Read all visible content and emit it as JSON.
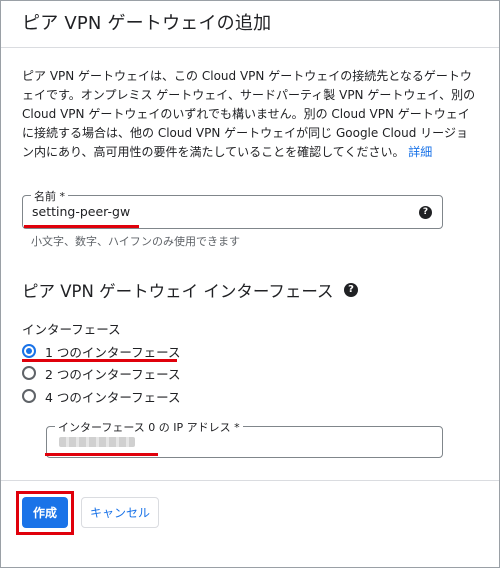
{
  "dialog": {
    "title": "ピア VPN ゲートウェイの追加"
  },
  "description": {
    "text": "ピア VPN ゲートウェイは、この Cloud VPN ゲートウェイの接続先となるゲートウェイです。オンプレミス ゲートウェイ、サードパーティ製 VPN ゲートウェイ、別の Cloud VPN ゲートウェイのいずれでも構いません。別の Cloud VPN ゲートウェイに接続する場合は、他の Cloud VPN ゲートウェイが同じ Google Cloud リージョン内にあり、高可用性の要件を満たしていることを確認してください。",
    "link_label": "詳細"
  },
  "name_field": {
    "label": "名前 *",
    "value": "setting-peer-gw",
    "hint": "小文字、数字、ハイフンのみ使用できます",
    "help_icon": "help-circle-icon"
  },
  "interface_section": {
    "title": "ピア VPN ゲートウェイ インターフェース",
    "help_icon": "help-circle-icon",
    "group_label": "インターフェース",
    "options": [
      {
        "label": "1 つのインターフェース",
        "checked": true
      },
      {
        "label": "2 つのインターフェース",
        "checked": false
      },
      {
        "label": "4 つのインターフェース",
        "checked": false
      }
    ],
    "ip_field": {
      "label": "インターフェース 0 の IP アドレス *"
    }
  },
  "footer": {
    "create_label": "作成",
    "cancel_label": "キャンセル"
  },
  "colors": {
    "accent": "#1a73e8",
    "annotation_red": "#e0000b"
  }
}
